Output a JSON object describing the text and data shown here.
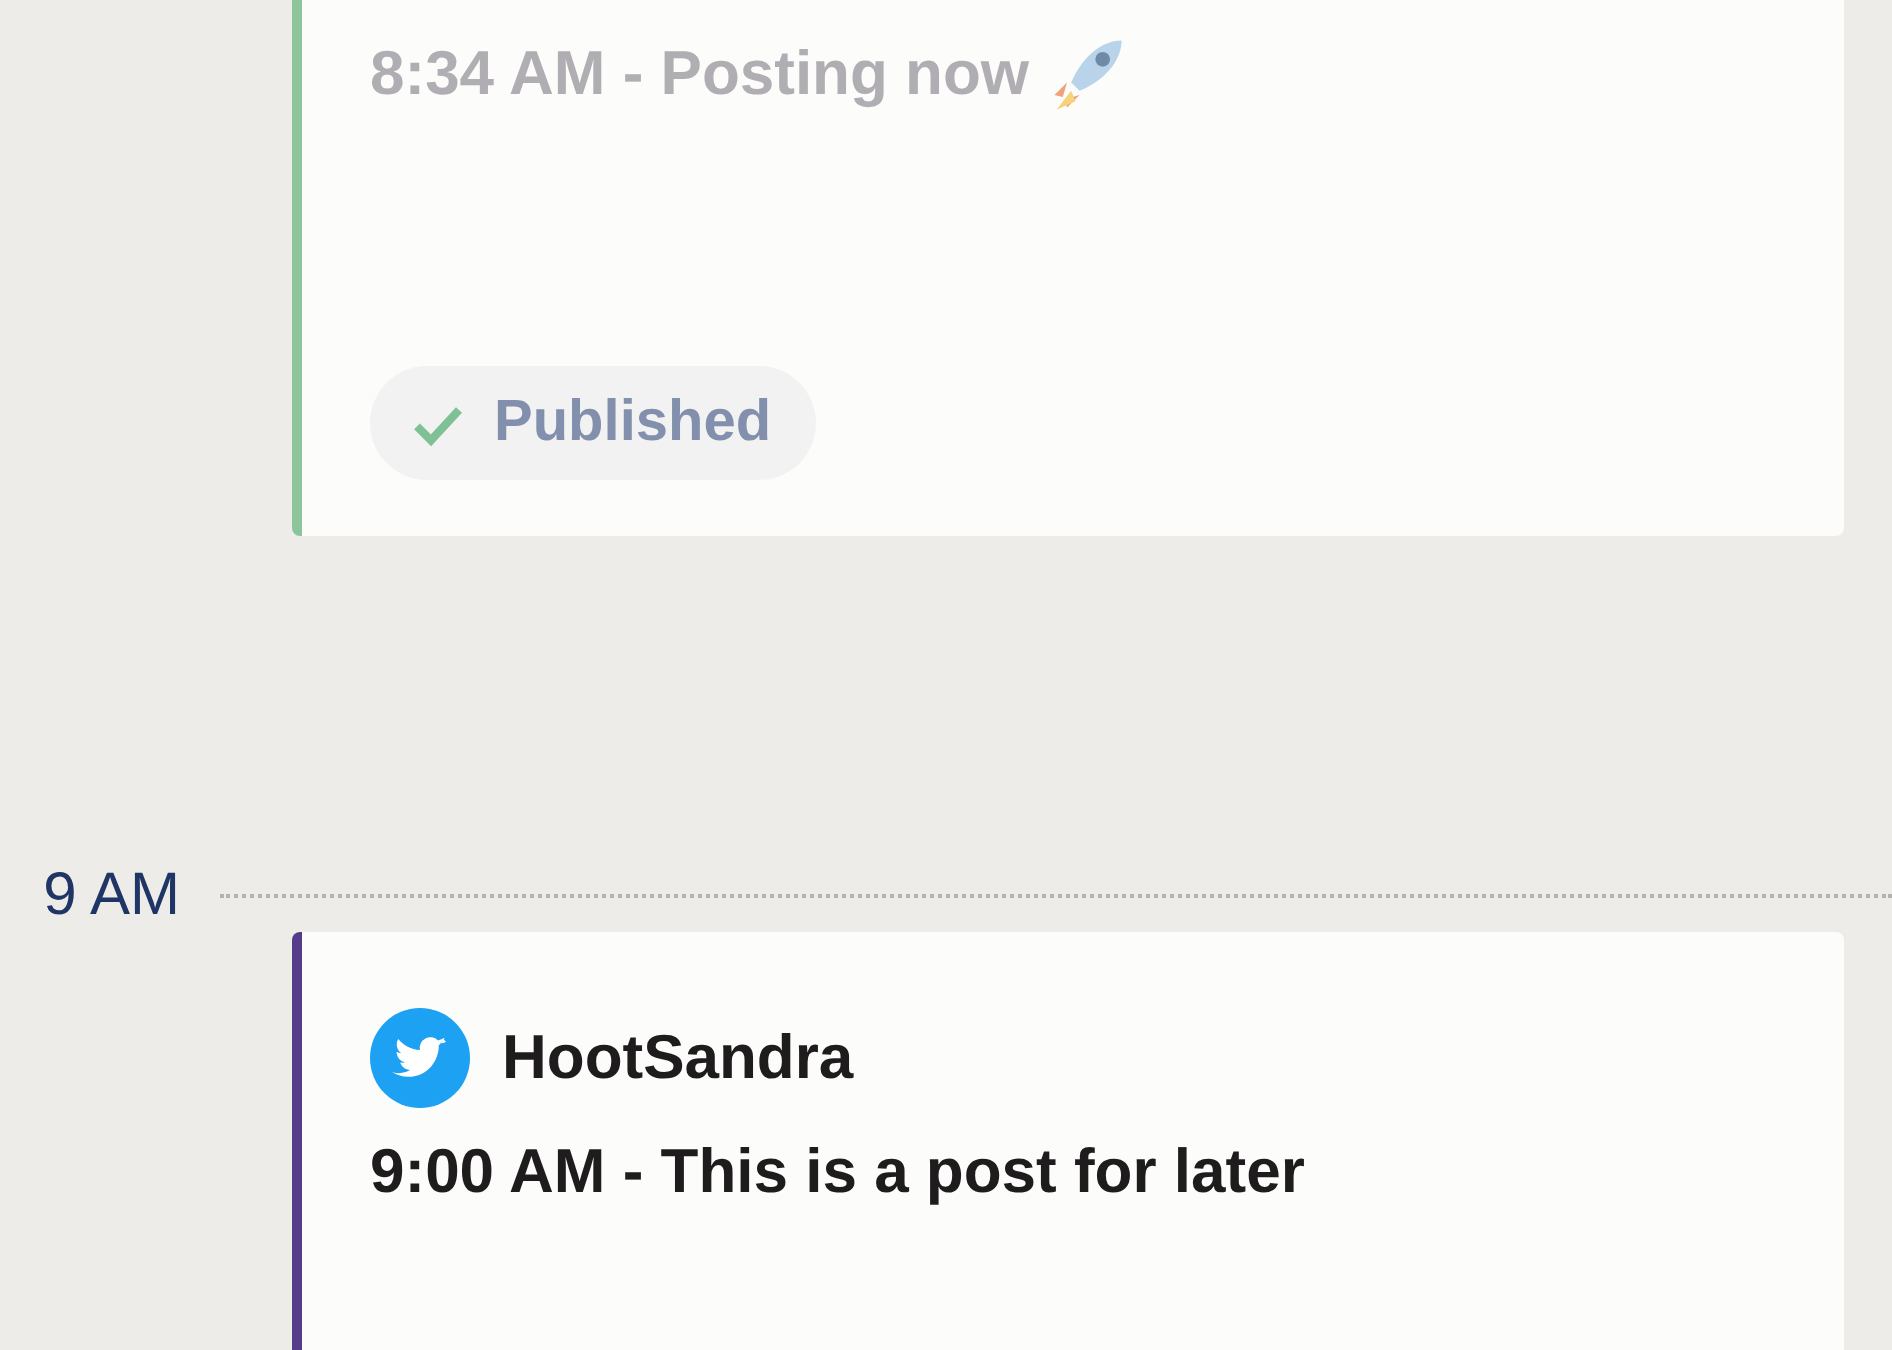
{
  "top_cards": [
    {
      "published": true,
      "text": "8:34 AM - Posting now",
      "badge": "Published"
    }
  ],
  "hour_slots": [
    {
      "label": "9 AM",
      "cards": [
        {
          "published": false,
          "account": "HootSandra",
          "text": "9:00 AM - This is a post for later"
        }
      ]
    }
  ]
}
